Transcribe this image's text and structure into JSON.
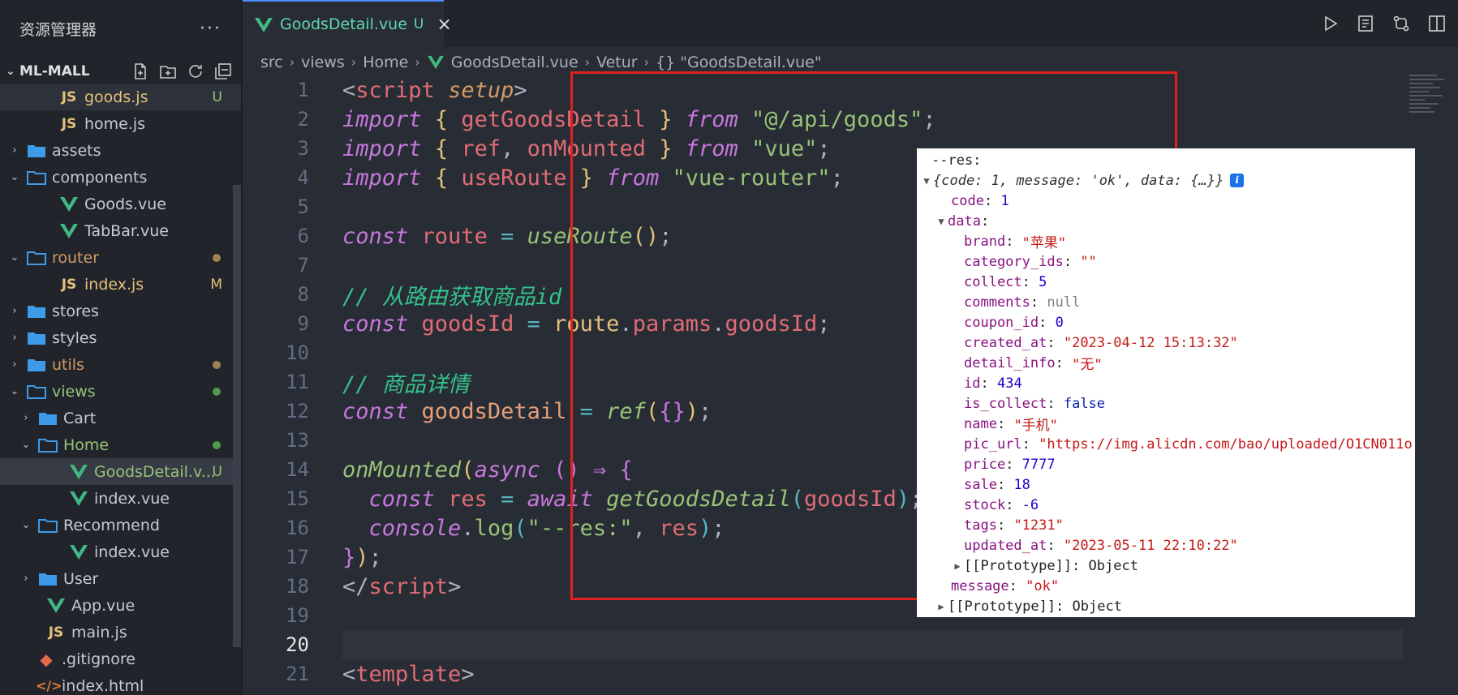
{
  "sidebar": {
    "title": "资源管理器",
    "more": "···",
    "project": "ML-MALL",
    "items": [
      {
        "label": "goods.js",
        "type": "js",
        "badge": "U",
        "indent": 72,
        "tw": "",
        "color": "yellow",
        "active": true
      },
      {
        "label": "home.js",
        "type": "js",
        "badge": "",
        "indent": 72,
        "tw": "",
        "color": "white"
      },
      {
        "label": "assets",
        "type": "folder",
        "badge": "",
        "indent": 32,
        "tw": "›",
        "color": "white"
      },
      {
        "label": "components",
        "type": "folder-open",
        "badge": "",
        "indent": 32,
        "tw": "⌄",
        "color": "white"
      },
      {
        "label": "Goods.vue",
        "type": "vue",
        "badge": "",
        "indent": 72,
        "tw": "",
        "color": "white"
      },
      {
        "label": "TabBar.vue",
        "type": "vue",
        "badge": "",
        "indent": 72,
        "tw": "",
        "color": "white"
      },
      {
        "label": "router",
        "type": "folder-open",
        "badge": "dot-orange",
        "indent": 32,
        "tw": "⌄",
        "color": "orange"
      },
      {
        "label": "index.js",
        "type": "js",
        "badge": "M",
        "indent": 72,
        "tw": "",
        "color": "yellow"
      },
      {
        "label": "stores",
        "type": "folder",
        "badge": "",
        "indent": 32,
        "tw": "›",
        "color": "white"
      },
      {
        "label": "styles",
        "type": "folder",
        "badge": "",
        "indent": 32,
        "tw": "›",
        "color": "white"
      },
      {
        "label": "utils",
        "type": "folder",
        "badge": "dot-orange",
        "indent": 32,
        "tw": "›",
        "color": "orange"
      },
      {
        "label": "views",
        "type": "folder-open",
        "badge": "dot-green",
        "indent": 32,
        "tw": "⌄",
        "color": "green"
      },
      {
        "label": "Cart",
        "type": "folder",
        "badge": "",
        "indent": 46,
        "tw": "›",
        "color": "white"
      },
      {
        "label": "Home",
        "type": "folder-open",
        "badge": "dot-green",
        "indent": 46,
        "tw": "⌄",
        "color": "green"
      },
      {
        "label": "GoodsDetail.v...",
        "type": "vue",
        "badge": "U",
        "indent": 84,
        "tw": "",
        "color": "green",
        "selected": true
      },
      {
        "label": "index.vue",
        "type": "vue",
        "badge": "",
        "indent": 84,
        "tw": "",
        "color": "white"
      },
      {
        "label": "Recommend",
        "type": "folder-open",
        "badge": "",
        "indent": 46,
        "tw": "⌄",
        "color": "white"
      },
      {
        "label": "index.vue",
        "type": "vue",
        "badge": "",
        "indent": 84,
        "tw": "",
        "color": "white"
      },
      {
        "label": "User",
        "type": "folder",
        "badge": "",
        "indent": 46,
        "tw": "›",
        "color": "white"
      },
      {
        "label": "App.vue",
        "type": "vue",
        "badge": "",
        "indent": 56,
        "tw": "",
        "color": "white"
      },
      {
        "label": "main.js",
        "type": "js",
        "badge": "",
        "indent": 56,
        "tw": "",
        "color": "white"
      },
      {
        "label": ".gitignore",
        "type": "git",
        "badge": "",
        "indent": 44,
        "tw": "",
        "color": "white"
      },
      {
        "label": "index.html",
        "type": "html",
        "badge": "",
        "indent": 44,
        "tw": "",
        "color": "white"
      }
    ]
  },
  "tab": {
    "label": "GoodsDetail.vue",
    "status": "U",
    "close": "×"
  },
  "breadcrumb": [
    "src",
    "views",
    "Home",
    "GoodsDetail.vue",
    "Vetur",
    "{} \"GoodsDetail.vue\""
  ],
  "code": {
    "line_numbers": [
      "1",
      "2",
      "3",
      "4",
      "5",
      "6",
      "7",
      "8",
      "9",
      "10",
      "11",
      "12",
      "13",
      "14",
      "15",
      "16",
      "17",
      "18",
      "19",
      "20",
      "21"
    ],
    "current_line": "20"
  },
  "console": {
    "label": "--res:",
    "summary": "{code: 1, message: 'ok', data: {…}}",
    "code_key": "code",
    "code_val": "1",
    "data_key": "data",
    "fields": [
      {
        "k": "brand",
        "v": "\"苹果\"",
        "t": "str"
      },
      {
        "k": "category_ids",
        "v": "\"\"",
        "t": "str"
      },
      {
        "k": "collect",
        "v": "5",
        "t": "num"
      },
      {
        "k": "comments",
        "v": "null",
        "t": "null"
      },
      {
        "k": "coupon_id",
        "v": "0",
        "t": "num"
      },
      {
        "k": "created_at",
        "v": "\"2023-04-12 15:13:32\"",
        "t": "str"
      },
      {
        "k": "detail_info",
        "v": "\"无\"",
        "t": "str"
      },
      {
        "k": "id",
        "v": "434",
        "t": "num"
      },
      {
        "k": "is_collect",
        "v": "false",
        "t": "bool"
      },
      {
        "k": "name",
        "v": "\"手机\"",
        "t": "str"
      },
      {
        "k": "pic_url",
        "v": "\"https://img.alicdn.com/bao/uploaded/O1CN011o",
        "t": "str"
      },
      {
        "k": "price",
        "v": "7777",
        "t": "num"
      },
      {
        "k": "sale",
        "v": "18",
        "t": "num"
      },
      {
        "k": "stock",
        "v": "-6",
        "t": "num"
      },
      {
        "k": "tags",
        "v": "\"1231\"",
        "t": "str"
      },
      {
        "k": "updated_at",
        "v": "\"2023-05-11 22:10:22\"",
        "t": "str"
      }
    ],
    "proto_inner": "[[Prototype]]: Object",
    "message_key": "message",
    "message_val": "\"ok\"",
    "proto_outer": "[[Prototype]]: Object"
  },
  "colors": {
    "accent": "#528bff",
    "highlight_box": "#e0201e"
  }
}
